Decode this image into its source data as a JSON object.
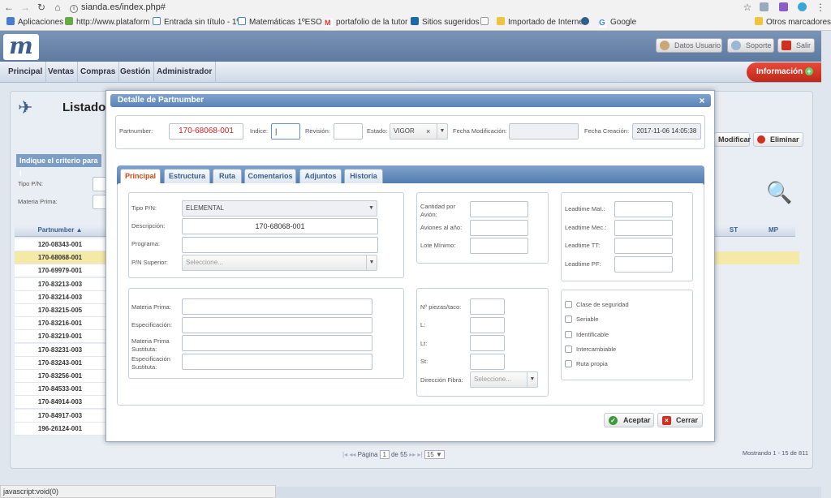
{
  "browser": {
    "url": "sianda.es/index.php#",
    "bookmarks": [
      "Aplicaciones",
      "http://www.plataform",
      "Entrada sin título - 1º",
      "Matemáticas 1ºESO -",
      "portafolio de la tutor",
      "Sitios sugeridos",
      "Importado de Interne",
      "Google",
      "Otros marcadores"
    ],
    "status_text": "javascript:void(0)"
  },
  "header": {
    "logo": "m",
    "datos_usuario": "Datos Usuario",
    "soporte": "Soporte",
    "salir": "Salir",
    "menu": [
      "Principal",
      "Ventas",
      "Compras",
      "Gestión",
      "Administrador"
    ],
    "informacion": "Información"
  },
  "background": {
    "title": "Listado",
    "criteria": "Indique el criterio para l",
    "tipo_pn": "Tipo P/N:",
    "materia_prima": "Materia Prima:",
    "col_partnumber": "Partnumber",
    "col_st": "ST",
    "col_mp": "MP",
    "modificar": "Modificar",
    "eliminar": "Eliminar",
    "rows": [
      "120-08343-001",
      "170-68068-001",
      "170-69979-001",
      "170-83213-003",
      "170-83214-003",
      "170-83215-005",
      "170-83216-001",
      "170-83219-001",
      "170-83231-003",
      "170-83243-001",
      "170-83256-001",
      "170-84533-001",
      "170-84914-003",
      "170-84917-003",
      "196-26124-001"
    ],
    "pager_label": "Página",
    "pager_page": "1",
    "pager_of": "de 55",
    "page_size": "15",
    "showing": "Mostrando 1 - 15 de 811"
  },
  "modal": {
    "title": "Detalle de Partnumber",
    "close": "×",
    "top": {
      "partnumber_label": "Partnumber:",
      "partnumber_value": "170-68068-001",
      "indice_label": "Indice:",
      "indice_value": "|",
      "revision_label": "Revisión:",
      "revision_value": "",
      "estado_label": "Estado:",
      "estado_value": "VIGOR",
      "fecha_mod_label": "Fecha Modificación:",
      "fecha_mod_value": "",
      "fecha_cre_label": "Fecha Creación:",
      "fecha_cre_value": "2017-11-06 14:05:38"
    },
    "tabs": [
      "Principal",
      "Estructura",
      "Ruta",
      "Comentarios",
      "Adjuntos",
      "Historia"
    ],
    "general": {
      "tipo_pn_label": "Tipo P/N:",
      "tipo_pn_value": "ELEMENTAL",
      "descripcion_label": "Descripción:",
      "descripcion_value": "170-68068-001",
      "programa_label": "Programa:",
      "pn_superior_label": "P/N Superior:",
      "pn_superior_placeholder": "Seleccione..."
    },
    "cantidades": {
      "cantidad_label": "Cantidad por Avión:",
      "aviones_label": "Aviones al año:",
      "lote_label": "Lote Mínimo:"
    },
    "leadtimes": {
      "mat": "Leadtime Mat.:",
      "mec": "Leadtime Mec.:",
      "tt": "Leadtime TT:",
      "pf": "Leadtime PF:"
    },
    "materiales": {
      "materia_prima": "Materia Prima:",
      "especificacion": "Especificación:",
      "mp_sustituta": "Materia Prima Sustituta:",
      "esp_sustituta": "Especificación Sustituta:"
    },
    "piezas": {
      "piezas_label": "Nº piezas/taco:",
      "l_label": "L:",
      "lt_label": "Lt:",
      "st_label": "St:",
      "direccion_label": "Dirección Fibra:",
      "direccion_placeholder": "Seleccione..."
    },
    "checks": [
      "Clase de seguridad",
      "Seriable",
      "Identificable",
      "Intercambiable",
      "Ruta propia"
    ],
    "aceptar": "Aceptar",
    "cerrar": "Cerrar"
  },
  "colors": {
    "accent": "#5b83b6",
    "danger": "#d03020",
    "selected_row": "#f5e9a8",
    "ok": "#3a9a3a"
  }
}
